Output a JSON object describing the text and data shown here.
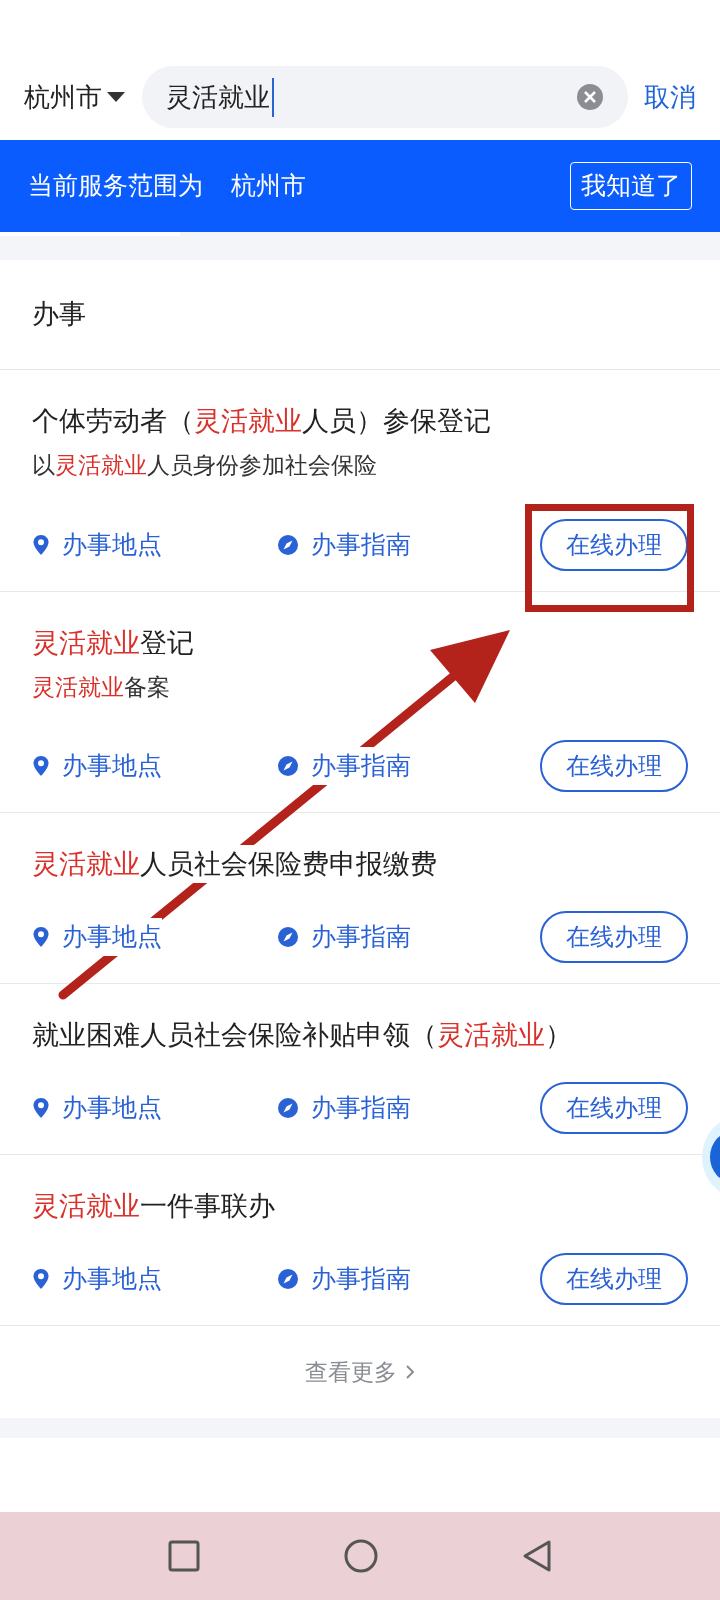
{
  "search": {
    "city": "杭州市",
    "value": "灵活就业",
    "cancel": "取消"
  },
  "banner": {
    "text": "当前服务范围为",
    "city": "杭州市",
    "button": "我知道了"
  },
  "section": {
    "title": "办事",
    "items": [
      {
        "title": [
          {
            "text": "个体劳动者（",
            "highlight": false
          },
          {
            "text": "灵活就业",
            "highlight": true
          },
          {
            "text": "人员）参保登记",
            "highlight": false
          }
        ],
        "subtitle": [
          {
            "text": "以",
            "highlight": false
          },
          {
            "text": "灵活就业",
            "highlight": true
          },
          {
            "text": "人员身份参加社会保险",
            "highlight": false
          }
        ],
        "location": "办事地点",
        "guide": "办事指南",
        "button": "在线办理"
      },
      {
        "title": [
          {
            "text": "灵活就业",
            "highlight": true
          },
          {
            "text": "登记",
            "highlight": false
          }
        ],
        "subtitle": [
          {
            "text": "灵活就业",
            "highlight": true
          },
          {
            "text": "备案",
            "highlight": false
          }
        ],
        "location": "办事地点",
        "guide": "办事指南",
        "button": "在线办理"
      },
      {
        "title": [
          {
            "text": "灵活就业",
            "highlight": true
          },
          {
            "text": "人员社会保险费申报缴费",
            "highlight": false
          }
        ],
        "location": "办事地点",
        "guide": "办事指南",
        "button": "在线办理"
      },
      {
        "title": [
          {
            "text": "就业困难人员社会保险补贴申领（",
            "highlight": false
          },
          {
            "text": "灵活就业",
            "highlight": true
          },
          {
            "text": "）",
            "highlight": false
          }
        ],
        "location": "办事地点",
        "guide": "办事指南",
        "button": "在线办理"
      },
      {
        "title": [
          {
            "text": "灵活就业",
            "highlight": true
          },
          {
            "text": "一件事联办",
            "highlight": false
          }
        ],
        "location": "办事地点",
        "guide": "办事指南",
        "button": "在线办理"
      }
    ],
    "more": "查看更多"
  }
}
